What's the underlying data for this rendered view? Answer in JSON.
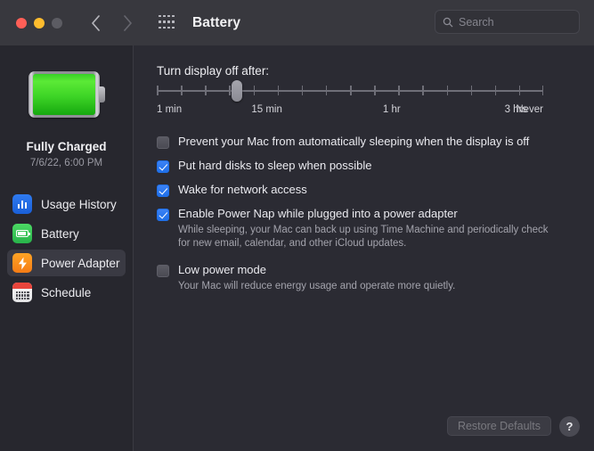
{
  "window": {
    "title": "Battery",
    "traffic_lights": [
      "close",
      "minimize",
      "zoom"
    ]
  },
  "toolbar": {
    "back_icon": "chevron-left-icon",
    "forward_icon": "chevron-right-icon",
    "grid_icon": "show-all-grid-icon",
    "search": {
      "placeholder": "Search",
      "value": "",
      "icon": "search-icon"
    }
  },
  "sidebar": {
    "battery_icon": "battery-full-icon",
    "status": "Fully Charged",
    "timestamp": "7/6/22, 6:00 PM",
    "items": [
      {
        "label": "Usage History",
        "icon": "usage-history-icon",
        "selected": false
      },
      {
        "label": "Battery",
        "icon": "battery-icon",
        "selected": false
      },
      {
        "label": "Power Adapter",
        "icon": "power-adapter-bolt-icon",
        "selected": true
      },
      {
        "label": "Schedule",
        "icon": "schedule-calendar-icon",
        "selected": false
      }
    ]
  },
  "main": {
    "slider": {
      "label": "Turn display off after:",
      "value_position_percent": 20.8,
      "tick_count": 17,
      "tick_labels": [
        {
          "text": "1 min",
          "percent": 0
        },
        {
          "text": "15 min",
          "percent": 24.5
        },
        {
          "text": "1 hr",
          "percent": 58.5
        },
        {
          "text": "3 hrs",
          "percent": 90
        },
        {
          "text": "Never",
          "percent": 100
        }
      ]
    },
    "options": [
      {
        "label": "Prevent your Mac from automatically sleeping when the display is off",
        "checked": false,
        "help": ""
      },
      {
        "label": "Put hard disks to sleep when possible",
        "checked": true,
        "help": ""
      },
      {
        "label": "Wake for network access",
        "checked": true,
        "help": ""
      },
      {
        "label": "Enable Power Nap while plugged into a power adapter",
        "checked": true,
        "help": "While sleeping, your Mac can back up using Time Machine and periodically check for new email, calendar, and other iCloud updates."
      },
      {
        "label": "Low power mode",
        "checked": false,
        "help": "Your Mac will reduce energy usage and operate more quietly."
      }
    ],
    "footer": {
      "restore_defaults_label": "Restore Defaults",
      "restore_defaults_enabled": false,
      "help_label": "?"
    }
  },
  "colors": {
    "window_bg": "#2b2b33",
    "toolbar_bg": "#38383e",
    "sidebar_bg": "#27272e",
    "accent_blue": "#3b82f6",
    "battery_green": "#4cd964",
    "power_orange": "#ffa425"
  }
}
